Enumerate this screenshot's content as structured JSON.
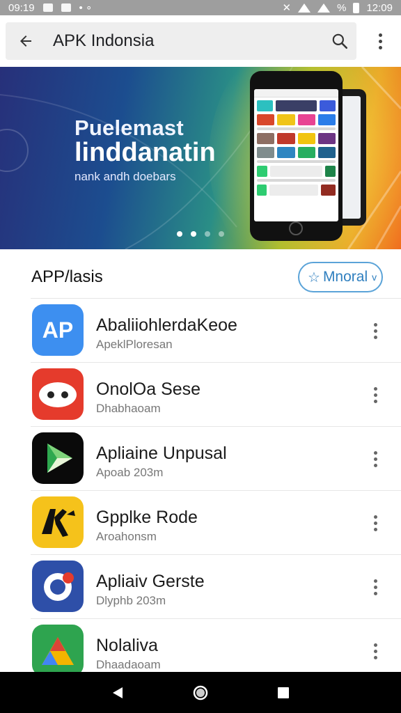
{
  "status_bar": {
    "time_left": "09:19",
    "battery": "%",
    "time_right": "12:09"
  },
  "app_bar": {
    "title": "APK Indonsia",
    "icons": [
      "back-arrow-icon",
      "search-icon",
      "overflow-menu-icon"
    ]
  },
  "banner": {
    "title_line1": "Puelemast",
    "title_line2": "linddanatin",
    "subtitle": "nank andh doebars",
    "page_count": 4,
    "active_page": 1
  },
  "section": {
    "title": "APP/lasis",
    "chip_label": "Mnoral",
    "chip_icon": "star-icon",
    "chip_caret": "v"
  },
  "apps": [
    {
      "name": "AbaliiohlerdaKeoe",
      "subtitle": "ApeklPloresan",
      "icon_text": "AP",
      "color": "#3d8ff0",
      "icon": "ap-logo-icon"
    },
    {
      "name": "OnolOa Sese",
      "subtitle": "Dhabhaoam",
      "icon_text": "",
      "color": "#e53b2c",
      "icon": "red-face-icon"
    },
    {
      "name": "Apliaine Unpusal",
      "subtitle": "Apoab 203m",
      "icon_text": "",
      "color": "#0a0a0a",
      "icon": "play-triangle-icon"
    },
    {
      "name": "Gpplke Rode",
      "subtitle": "Aroahonsm",
      "icon_text": "",
      "color": "#f5c21b",
      "icon": "black-glyph-icon"
    },
    {
      "name": "Apliaiv Gerste",
      "subtitle": "Dlyphb 203m",
      "icon_text": "",
      "color": "#2e4fa8",
      "icon": "ring-logo-icon"
    },
    {
      "name": "Nolaliva",
      "subtitle": "Dhaadaoam",
      "icon_text": "",
      "color": "#2ea44f",
      "icon": "drive-triangle-icon"
    }
  ],
  "nav_bar": {
    "buttons": [
      "back-triangle-icon",
      "home-circle-icon",
      "recents-square-icon"
    ]
  }
}
